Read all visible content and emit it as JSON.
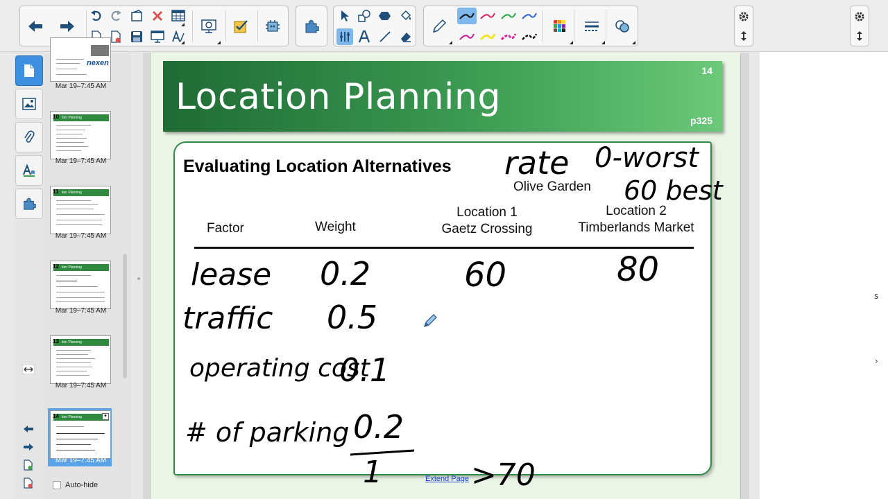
{
  "slide": {
    "number": "14",
    "title": "Location Planning",
    "reference": "p325",
    "content_title": "Evaluating Location Alternatives",
    "competitor": "Olive Garden",
    "columns": {
      "factor": "Factor",
      "weight": "Weight",
      "location1_line1": "Location 1",
      "location1_line2": "Gaetz Crossing",
      "location2_line1": "Location 2",
      "location2_line2": "Timberlands Market"
    },
    "handwriting": {
      "rate_note": "rate",
      "worst_note": "0-worst",
      "best_note": "60 best",
      "rows": [
        {
          "factor": "lease",
          "weight": "0.2",
          "loc1": "60",
          "loc2": "80"
        },
        {
          "factor": "traffic",
          "weight": "0.5",
          "loc1": "",
          "loc2": ""
        },
        {
          "factor": "operating cost",
          "weight": "0.1",
          "loc1": "",
          "loc2": ""
        },
        {
          "factor": "# of parking",
          "weight": "0.2",
          "loc1": "",
          "loc2": ""
        }
      ],
      "weight_total": "1",
      "total_note": ">70"
    },
    "extend_link": "Extend Page"
  },
  "sorter": {
    "thumbnails": [
      {
        "num": "",
        "title": "",
        "timestamp": "Mar 19–7:45 AM",
        "logo": "nexen"
      },
      {
        "num": "10",
        "title": "tion Planning",
        "timestamp": "Mar 19–7:45 AM"
      },
      {
        "num": "11",
        "title": "tion Planning",
        "timestamp": "Mar 19–7:45 AM"
      },
      {
        "num": "12",
        "title": "tion Planning",
        "timestamp": "Mar 19–7:45 AM"
      },
      {
        "num": "13",
        "title": "tion Planning",
        "timestamp": "Mar 19–7:45 AM"
      },
      {
        "num": "14",
        "title": "tion Planning",
        "timestamp": "Mar 19–7:45 AM"
      }
    ],
    "auto_hide_label": "Auto-hide"
  },
  "colors": {
    "accent": "#3d8fe0",
    "banner_dark": "#1f6b35",
    "banner_light": "#6cc97a",
    "page_bg": "#ebf5e6"
  },
  "icons": {
    "toolbar": [
      "arrow-left-icon",
      "arrow-right-icon",
      "undo-icon",
      "redo-icon",
      "screen-shade-icon",
      "delete-icon",
      "table-icon",
      "new-page-icon",
      "delete-page-icon",
      "save-icon",
      "display-icon",
      "measure-icon",
      "document-camera-icon",
      "response-icon",
      "add-ons-icon",
      "puzzle-icon",
      "select-icon",
      "shapes-icon",
      "fill-icon",
      "paint-bucket-icon",
      "text-icon",
      "line-icon",
      "eraser-icon",
      "pen-icon",
      "color-swatches-icon",
      "line-style-icon",
      "shape-recognition-icon",
      "settings-icon",
      "resize-toolbar-icon"
    ]
  }
}
